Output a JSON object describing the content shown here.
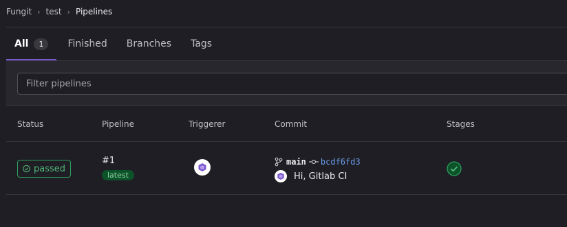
{
  "breadcrumb": {
    "items": [
      "Fungit",
      "test",
      "Pipelines"
    ]
  },
  "tabs": [
    {
      "label": "All",
      "count": "1",
      "active": true
    },
    {
      "label": "Finished"
    },
    {
      "label": "Branches"
    },
    {
      "label": "Tags"
    }
  ],
  "filter": {
    "placeholder": "Filter pipelines"
  },
  "table": {
    "headers": [
      "Status",
      "Pipeline",
      "Triggerer",
      "Commit",
      "Stages"
    ],
    "rows": [
      {
        "status": "passed",
        "pipeline_id": "#1",
        "pipeline_badge": "latest",
        "triggerer_icon": "avatar-icon",
        "branch": "main",
        "sha": "bcdf6fd3",
        "commit_title": "Hi, Gitlab CI",
        "stage_status": "success-icon"
      }
    ]
  },
  "colors": {
    "success": "#52b87a",
    "accent": "#7b58cf",
    "link": "#6a9ce8"
  }
}
